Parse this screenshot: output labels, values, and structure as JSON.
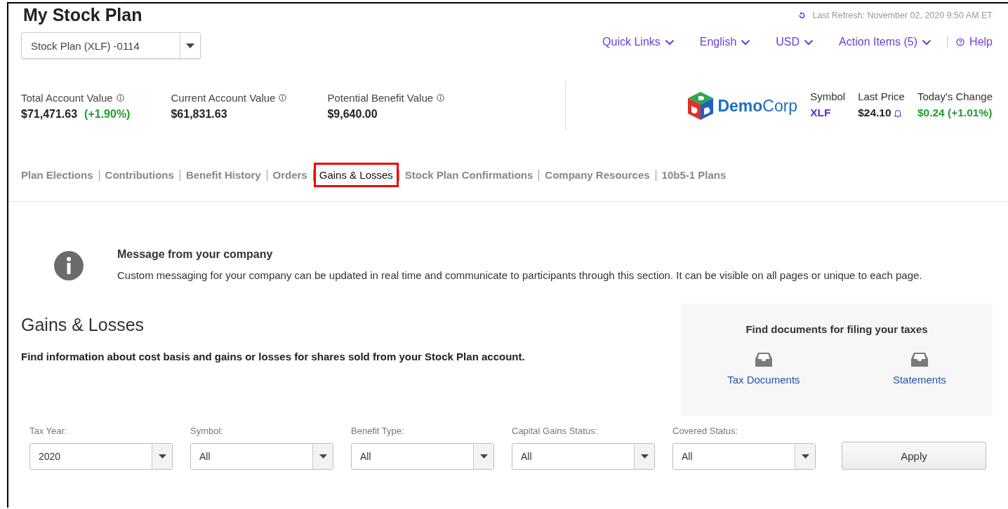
{
  "header": {
    "title": "My Stock Plan",
    "plan_select": {
      "value": "Stock Plan (XLF) -0114"
    },
    "last_refresh": "Last Refresh: November 02, 2020 9:50 AM ET"
  },
  "top_links": [
    {
      "label": "Quick Links",
      "kind": "dropdown"
    },
    {
      "label": "English",
      "kind": "dropdown"
    },
    {
      "label": "USD",
      "kind": "dropdown"
    },
    {
      "label": "Action Items (5)",
      "kind": "dropdown"
    },
    {
      "label": "Help",
      "kind": "help"
    }
  ],
  "summary": [
    {
      "label": "Total Account Value",
      "value": "$71,471.63",
      "change": "(+1.90%)"
    },
    {
      "label": "Current Account Value",
      "value": "$61,831.63"
    },
    {
      "label": "Potential Benefit Value",
      "value": "$9,640.00"
    }
  ],
  "company": {
    "logo_text": "**Demo**Corp",
    "quote": [
      {
        "label": "Symbol",
        "value": "XLF",
        "kind": "symbol"
      },
      {
        "label": "Last Price",
        "value": "$24.10",
        "kind": "price"
      },
      {
        "label": "Today's Change",
        "value": "$0.24 (+1.01%)",
        "kind": "change"
      }
    ]
  },
  "tabs": [
    {
      "label": "Plan Elections",
      "selected": false
    },
    {
      "label": "Contributions",
      "selected": false
    },
    {
      "label": "Benefit History",
      "selected": false
    },
    {
      "label": "Orders",
      "selected": false
    },
    {
      "label": "Gains & Losses",
      "selected": true
    },
    {
      "label": "Stock Plan Confirmations",
      "selected": false
    },
    {
      "label": "Company Resources",
      "selected": false
    },
    {
      "label": "10b5-1 Plans",
      "selected": false
    }
  ],
  "message": {
    "title": "Message from your company",
    "body": "Custom messaging for your company can be updated in real time and communicate to participants through this section. It can be visible on all pages or unique to each page."
  },
  "section": {
    "title": "Gains & Losses",
    "description": "Find information about cost basis and gains or losses for shares sold from your Stock Plan account."
  },
  "tax_panel": {
    "title": "Find documents for filing your taxes",
    "links": [
      "Tax Documents",
      "Statements"
    ]
  },
  "filters": [
    {
      "label": "Tax Year:",
      "value": "2020"
    },
    {
      "label": "Symbol:",
      "value": "All"
    },
    {
      "label": "Benefit Type:",
      "value": "All"
    },
    {
      "label": "Capital Gains Status:",
      "value": "All"
    },
    {
      "label": "Covered Status:",
      "value": "All"
    }
  ],
  "apply_button": "Apply"
}
